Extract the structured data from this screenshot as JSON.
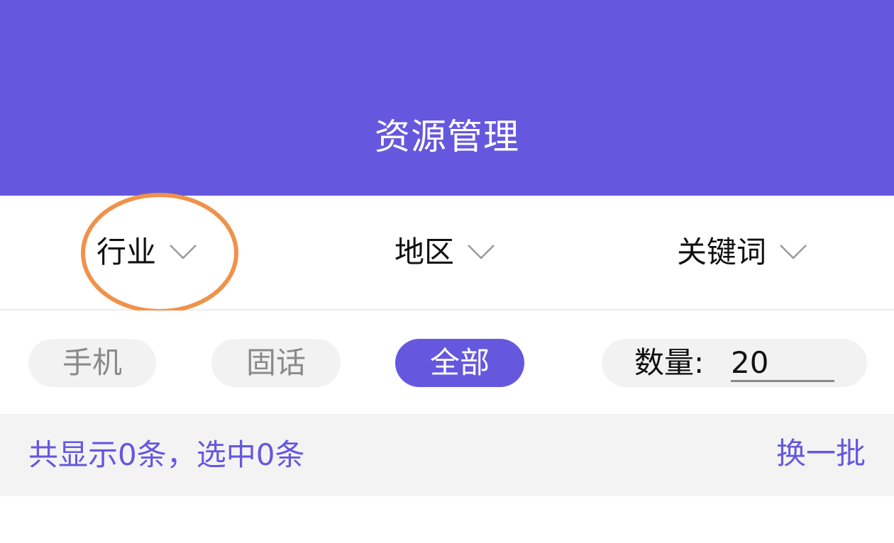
{
  "header": {
    "title": "资源管理"
  },
  "filters": [
    {
      "label": "行业",
      "icon": "chevron-down-icon"
    },
    {
      "label": "地区",
      "icon": "chevron-down-icon"
    },
    {
      "label": "关键词",
      "icon": "chevron-down-icon"
    }
  ],
  "type_options": [
    {
      "label": "手机",
      "selected": false
    },
    {
      "label": "固话",
      "selected": false
    },
    {
      "label": "全部",
      "selected": true
    }
  ],
  "quantity": {
    "label": "数量:",
    "value": "20"
  },
  "summary": {
    "text": "共显示0条，选中0条",
    "refresh_label": "换一批"
  },
  "colors": {
    "primary": "#6558de",
    "highlight": "#f0924a",
    "pill_bg": "#f2f2f2",
    "summary_bg": "#f3f3f4"
  }
}
